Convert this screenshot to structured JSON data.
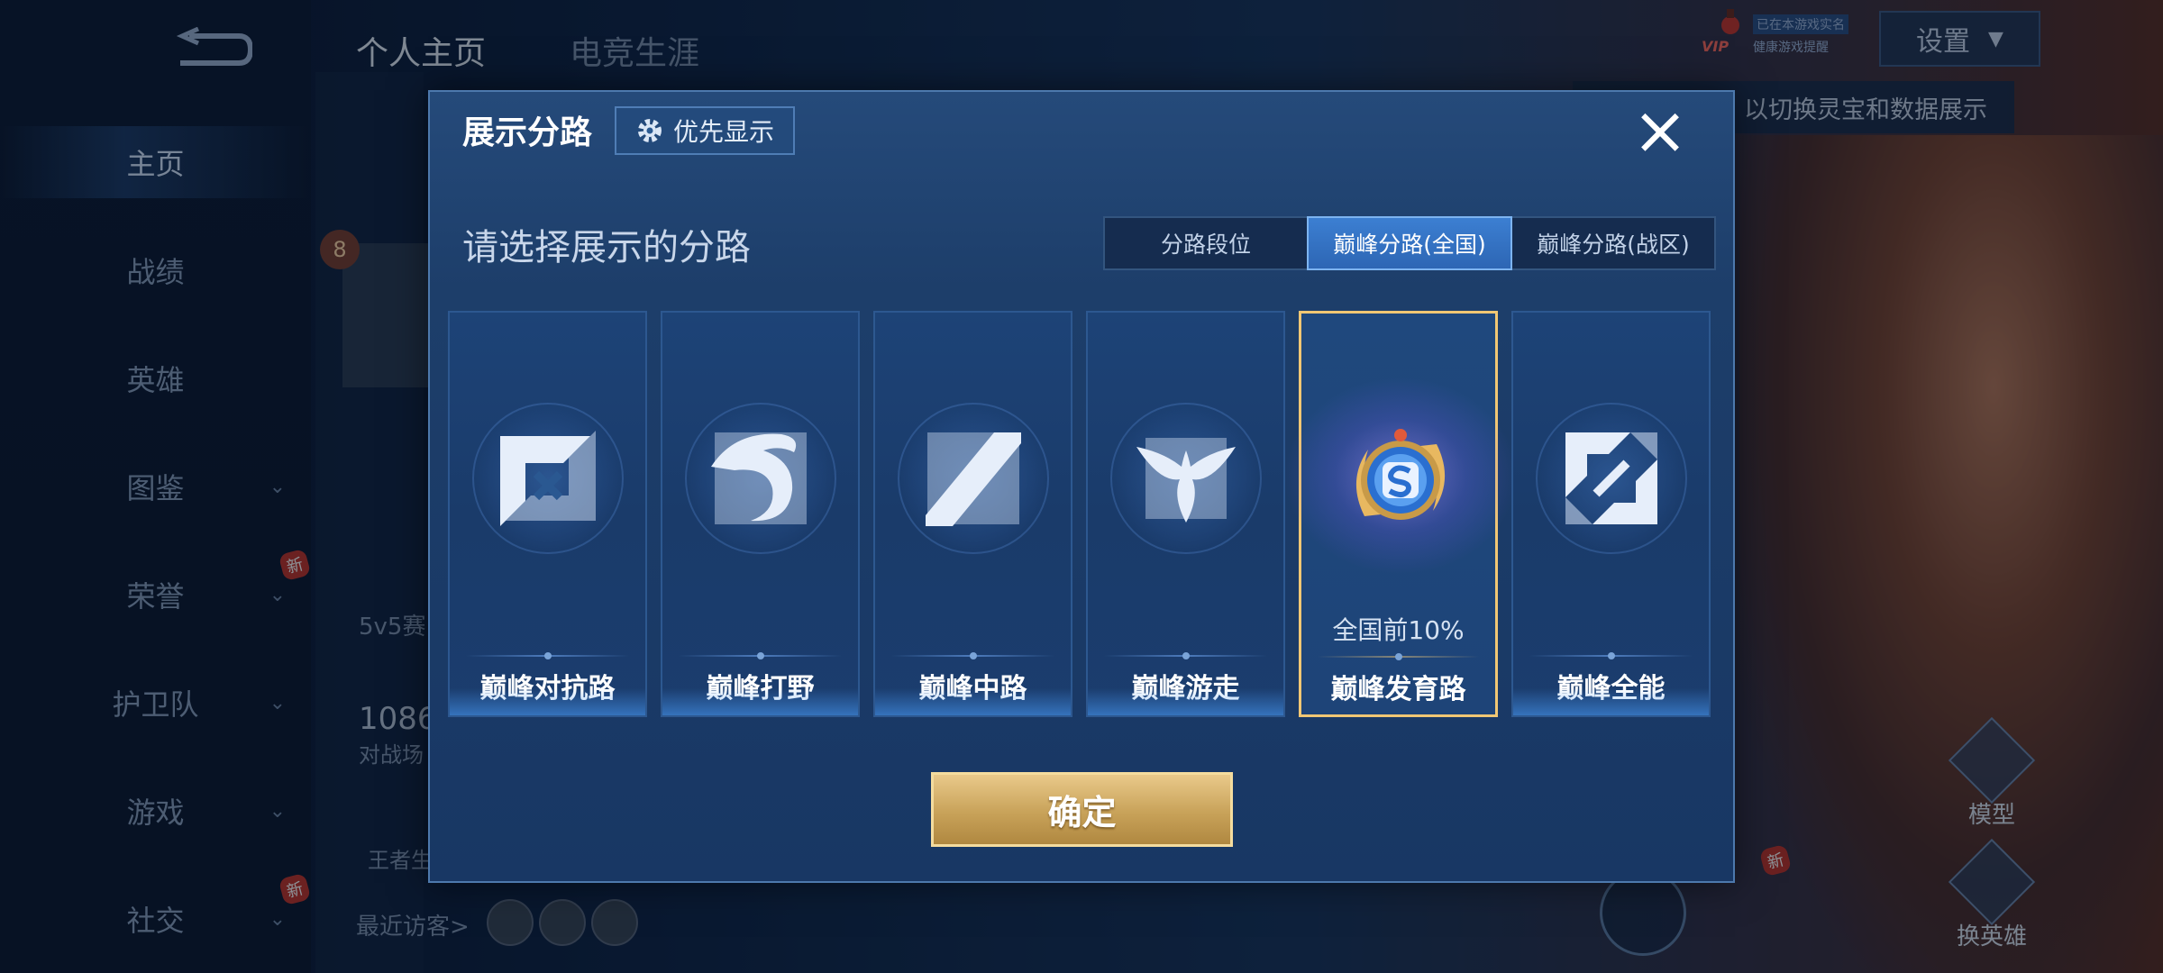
{
  "background": {
    "top_tabs": [
      "个人主页",
      "电竞生涯"
    ],
    "nav": [
      {
        "label": "主页",
        "active": true,
        "chevron": false,
        "new": false
      },
      {
        "label": "战绩",
        "active": false,
        "chevron": false,
        "new": false
      },
      {
        "label": "英雄",
        "active": false,
        "chevron": false,
        "new": false
      },
      {
        "label": "图鉴",
        "active": false,
        "chevron": true,
        "new": false
      },
      {
        "label": "荣誉",
        "active": false,
        "chevron": true,
        "new": true
      },
      {
        "label": "护卫队",
        "active": false,
        "chevron": true,
        "new": false
      },
      {
        "label": "游戏",
        "active": false,
        "chevron": true,
        "new": false
      },
      {
        "label": "社交",
        "active": false,
        "chevron": true,
        "new": true
      }
    ],
    "new_badge": "新",
    "rank_number": "8",
    "text_5v5": "5v5赛",
    "text_1086": "1086",
    "text_battle": "对战场",
    "text_king": "王者生",
    "recent_visitors": "最近访客>",
    "settings_label": "设置",
    "vip_label": "VIP",
    "status_line1": "已在本游戏实名",
    "status_line2": "健康游戏提醒",
    "tip_text": "以切换灵宝和数据展示",
    "model_label": "模型",
    "change_hero_label": "换英雄"
  },
  "modal": {
    "title": "展示分路",
    "priority_button": "优先显示",
    "close_icon": "×",
    "prompt": "请选择展示的分路",
    "segments": [
      {
        "label": "分路段位",
        "active": false
      },
      {
        "label": "巅峰分路(全国)",
        "active": true
      },
      {
        "label": "巅峰分路(战区)",
        "active": false
      }
    ],
    "cards": [
      {
        "label": "巅峰对抗路",
        "icon": "clash-lane-icon",
        "selected": false,
        "stat": ""
      },
      {
        "label": "巅峰打野",
        "icon": "jungle-dragon-icon",
        "selected": false,
        "stat": ""
      },
      {
        "label": "巅峰中路",
        "icon": "mid-lane-icon",
        "selected": false,
        "stat": ""
      },
      {
        "label": "巅峰游走",
        "icon": "roam-wings-icon",
        "selected": false,
        "stat": ""
      },
      {
        "label": "巅峰发育路",
        "icon": "farm-lane-badge-icon",
        "selected": true,
        "stat": "全国前10%"
      },
      {
        "label": "巅峰全能",
        "icon": "all-round-icon",
        "selected": false,
        "stat": ""
      }
    ],
    "confirm_button": "确定"
  },
  "colors": {
    "accent_gold": "#f1c774",
    "tab_active": "#3c7fd2",
    "modal_bg": "#1d3e6a"
  }
}
